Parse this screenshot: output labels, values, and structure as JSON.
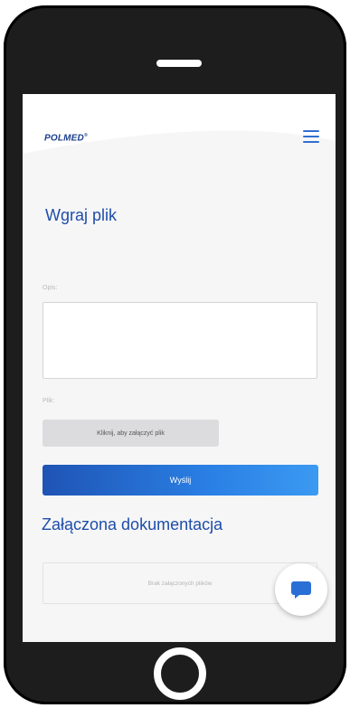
{
  "header": {
    "logo_text": "POLMED",
    "logo_mark": "®",
    "menu_icon": "hamburger-menu-icon"
  },
  "upload": {
    "title": "Wgraj plik",
    "description_label": "Opis:",
    "description_value": "",
    "file_label": "Plik:",
    "attach_button_label": "Kliknij, aby załączyć plik",
    "submit_button_label": "Wyślij"
  },
  "attachments": {
    "title": "Załączona dokumentacja",
    "empty_text": "Brak załączonych plików"
  },
  "chat": {
    "icon": "chat-bubble-icon"
  },
  "colors": {
    "brand_blue": "#1e4da8",
    "accent_blue": "#2a7fe4",
    "screen_bg": "#f6f6f7",
    "phone_body": "#1d1d1d"
  }
}
